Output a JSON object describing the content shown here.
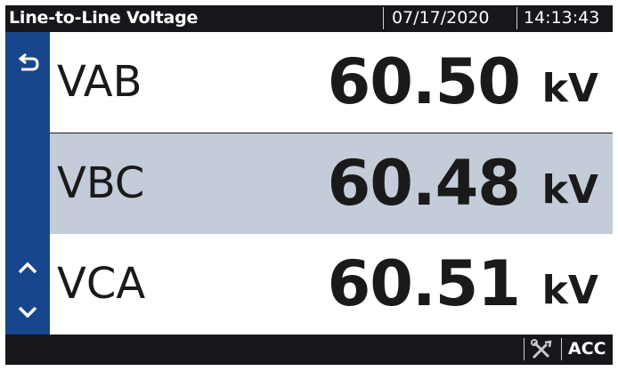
{
  "header": {
    "title": "Line-to-Line Voltage",
    "date": "07/17/2020",
    "time": "14:13:43"
  },
  "rows": [
    {
      "label": "VAB",
      "value": "60.50",
      "unit": "kV",
      "selected": false
    },
    {
      "label": "VBC",
      "value": "60.48",
      "unit": "kV",
      "selected": true
    },
    {
      "label": "VCA",
      "value": "60.51",
      "unit": "kV",
      "selected": false
    }
  ],
  "footer": {
    "acc_label": "ACC"
  },
  "icons": {
    "back": "back-arrow-icon",
    "up": "chevron-up-icon",
    "down": "chevron-down-icon",
    "tools": "wrench-screwdriver-icon"
  },
  "colors": {
    "nav_bar": "#18468d",
    "selected_row": "#c3ccd8",
    "bar_background": "#15171b",
    "row_background": "#ffffff"
  }
}
